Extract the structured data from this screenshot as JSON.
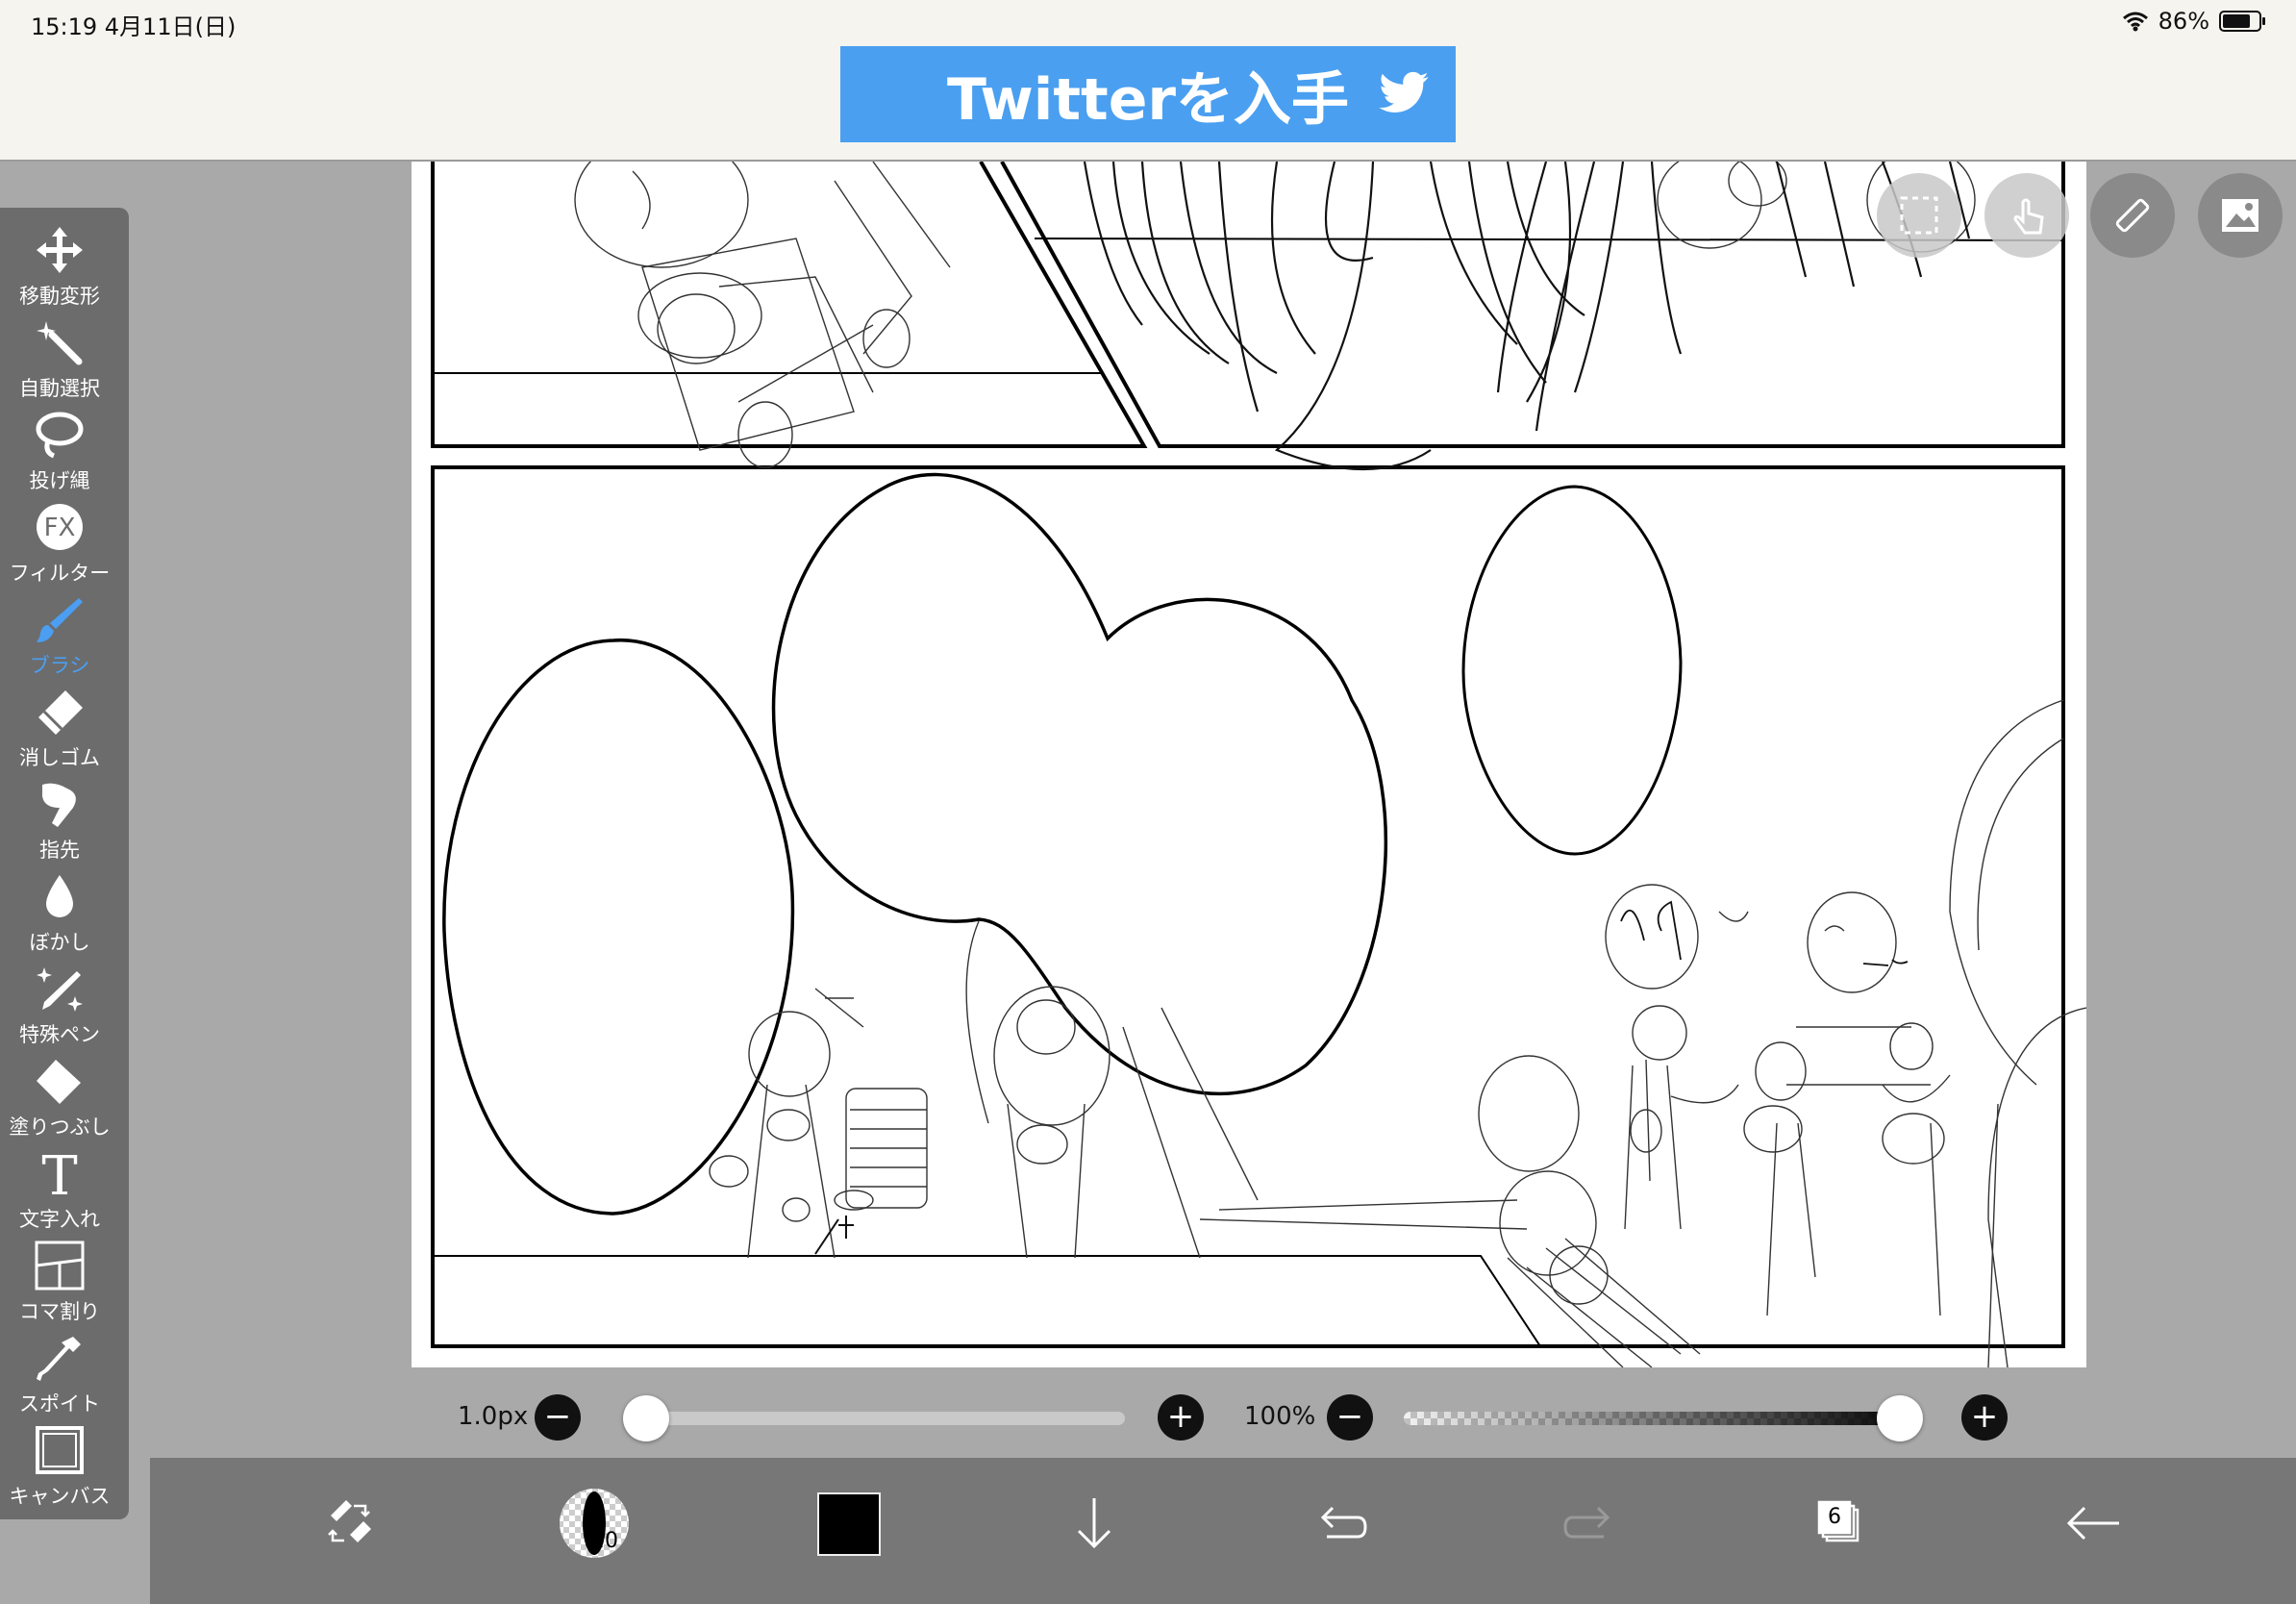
{
  "status_bar": {
    "time_date": "15:19   4月11日(日)",
    "battery_pct": "86%",
    "battery_level": 0.86
  },
  "ad": {
    "text": "Twitterを入手"
  },
  "tools": [
    {
      "label": "移動変形",
      "icon": "move-icon"
    },
    {
      "label": "自動選択",
      "icon": "magic-wand-icon"
    },
    {
      "label": "投げ縄",
      "icon": "lasso-icon"
    },
    {
      "label": "フィルター",
      "icon": "fx-icon"
    },
    {
      "label": "ブラシ",
      "icon": "brush-icon",
      "active": true
    },
    {
      "label": "消しゴム",
      "icon": "eraser-icon"
    },
    {
      "label": "指先",
      "icon": "finger-icon"
    },
    {
      "label": "ぼかし",
      "icon": "blur-drop-icon"
    },
    {
      "label": "特殊ペン",
      "icon": "special-pen-icon"
    },
    {
      "label": "塗りつぶし",
      "icon": "fill-icon"
    },
    {
      "label": "文字入れ",
      "icon": "text-icon"
    },
    {
      "label": "コマ割り",
      "icon": "frame-divide-icon"
    },
    {
      "label": "スポイト",
      "icon": "eyedropper-icon"
    },
    {
      "label": "キャンバス",
      "icon": "canvas-icon"
    }
  ],
  "brush": {
    "size_label": "1.0px",
    "size_level": 0.0,
    "opacity_label": "100%",
    "opacity_level": 1.0,
    "indicator_text": "1.0"
  },
  "colors": {
    "accent": "#4b9ef2",
    "current_color": "#000000",
    "ad_blue": "#4a9ff0"
  },
  "layers": {
    "count": "6"
  }
}
